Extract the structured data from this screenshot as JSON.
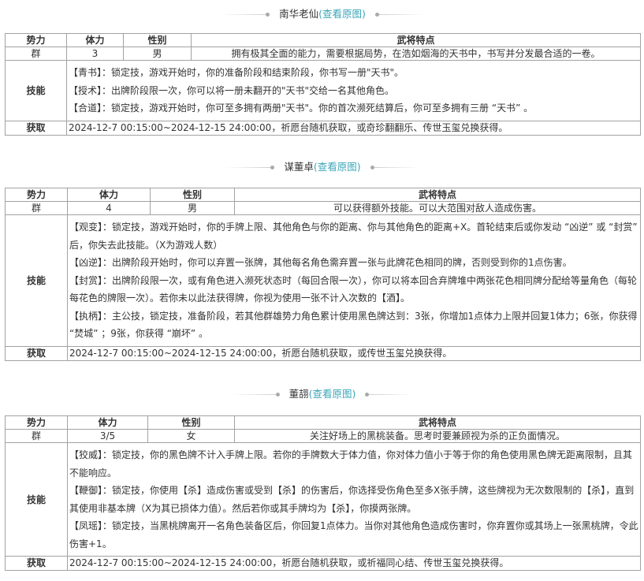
{
  "view_original_label": "(查看原图)",
  "headers": {
    "faction": "势力",
    "hp": "体力",
    "gender": "性别",
    "traits": "武将特点",
    "skills": "技能",
    "acquire": "获取"
  },
  "generals": [
    {
      "name": "南华老仙",
      "faction": "群",
      "hp": "3",
      "gender": "男",
      "traits": "拥有极其全面的能力，需要根据局势，在浩如烟海的天书中，书写并分发最合适的一卷。",
      "skills": [
        "【青书】：锁定技，游戏开始时，你的准备阶段和结束阶段，你书写一册\"天书\"。",
        "【授术】：出牌阶段限一次，你可以将一册未翻开的\"天书\"交给一名其他角色。",
        "【合道】：锁定技，游戏开始时，你可至多拥有两册\"天书\"。你的首次濒死结算后，你可至多拥有三册 “天书” 。"
      ],
      "acquire": "2024-12-7 00:15:00~2024-12-15 24:00:00，祈愿台随机获取，或奇珍翻翻乐、传世玉玺兑换获得。"
    },
    {
      "name": "谋董卓",
      "faction": "群",
      "hp": "4",
      "gender": "男",
      "traits": "可以获得额外技能。可以大范围对敌人造成伤害。",
      "skills": [
        "【观变】：锁定技，游戏开始时，你的手牌上限、其他角色与你的距离、你与其他角色的距离+X。首轮结束后或你发动 “凶逆” 或 “封赏” 后，你失去此技能。（X为游戏人数）",
        "【凶逆】：出牌阶段开始时，你可以弃置一张牌，其他每名角色需弃置一张与此牌花色相同的牌，否则受到你的1点伤害。",
        "【封赏】：出牌阶段限一次，或有角色进入濒死状态时（每回合限一次），你可以将本回合弃牌堆中两张花色相同牌分配给等量角色（每轮每花色的牌限一次）。若你未以此法获得牌，你视为使用一张不计入次数的【酒】。",
        "【执柄】：主公技，锁定技，准备阶段，若其他群雄势力角色累计使用黑色牌达到：3张，你增加1点体力上限并回复1体力；6张，你获得 “焚城” ；9张，你获得 “崩坏” 。"
      ],
      "acquire": "2024-12-7 00:15:00~2024-12-15 24:00:00，祈愿台随机获取，或传世玉玺兑换获得。"
    },
    {
      "name": "董翓",
      "faction": "群",
      "hp": "3/5",
      "gender": "女",
      "traits": "关注好场上的黑桃装备。思考时要兼顾视为杀的正负面情况。",
      "skills": [
        "【狡威】：锁定技，你的黑色牌不计入手牌上限。若你的手牌数大于体力值，你对体力值小于等于你的角色使用黑色牌无距离限制，且其不能响应。",
        "【鞭御】：锁定技，你使用【杀】造成伤害或受到【杀】的伤害后，你选择受伤角色至多X张手牌，这些牌视为无次数限制的【杀】，直到其使用非基本牌（X为其已损体力值）。然后若你或其手牌均为【杀】，你摸两张牌。",
        "【凤瑶】：锁定技，当黑桃牌离开一名角色装备区后，你回复1点体力。当你对其他角色造成伤害时，你弃置你或其场上一张黑桃牌，令此伤害+1。"
      ],
      "acquire": "2024-12-7 00:15:00~2024-12-15 24:00:00，祈愿台随机获取，或祈福同心结、传世玉玺兑换获得。"
    }
  ]
}
